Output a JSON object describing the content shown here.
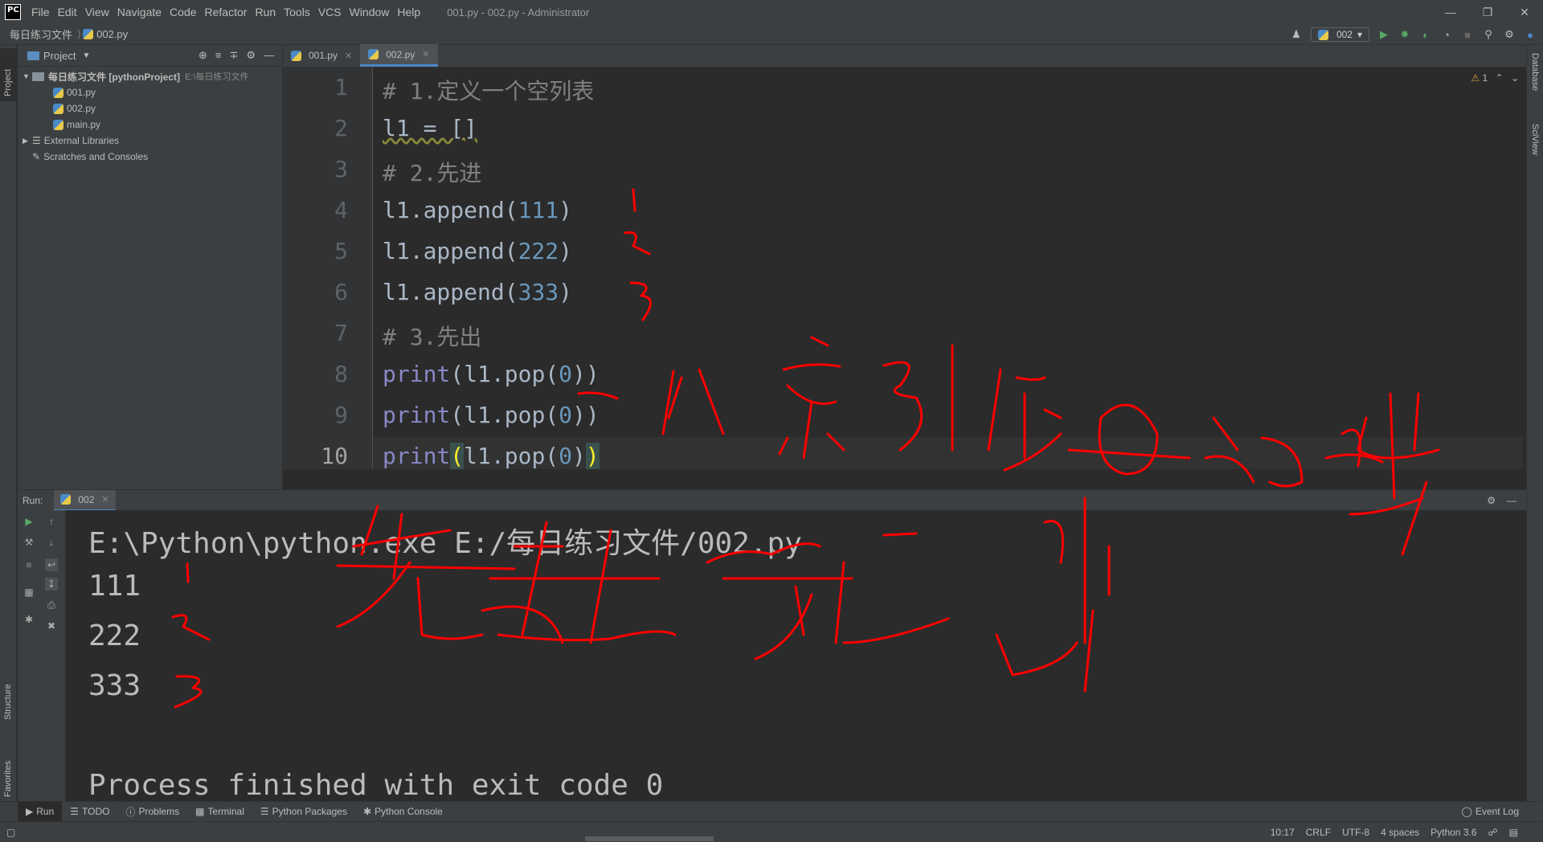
{
  "titlebar": {
    "logo_text": "PC",
    "menus": [
      "File",
      "Edit",
      "View",
      "Navigate",
      "Code",
      "Refactor",
      "Run",
      "Tools",
      "VCS",
      "Window",
      "Help"
    ],
    "window_title": "001.py - 002.py - Administrator"
  },
  "navbar": {
    "project": "每日练习文件",
    "file": "002.py",
    "run_config": "002"
  },
  "project_panel": {
    "header": "Project",
    "root_name": "每日练习文件 [pythonProject]",
    "root_path": "E:\\每日练习文件",
    "files": [
      "001.py",
      "002.py",
      "main.py"
    ],
    "external_libraries": "External Libraries",
    "scratches": "Scratches and Consoles"
  },
  "left_stripe": {
    "project": "Project",
    "structure": "Structure",
    "favorites": "Favorites"
  },
  "right_stripe": {
    "database": "Database",
    "sciview": "SciView"
  },
  "editor": {
    "tabs": [
      {
        "label": "001.py",
        "active": false
      },
      {
        "label": "002.py",
        "active": true
      }
    ],
    "warning_count": "1",
    "line_numbers": [
      "1",
      "2",
      "3",
      "4",
      "5",
      "6",
      "7",
      "8",
      "9",
      "10"
    ],
    "lines": {
      "l1_comment": "# 1.定义一个空列表",
      "l2_var": "l1 = []",
      "l3_comment": "# 2.先进",
      "l4_obj": "l1.append(",
      "l4_num": "111",
      "l5_obj": "l1.append(",
      "l5_num": "222",
      "l6_obj": "l1.append(",
      "l6_num": "333",
      "close_paren": ")",
      "l7_comment": "# 3.先出",
      "print_kw": "print",
      "pop_open": "(l1.pop(",
      "pop_zero": "0",
      "pop_close": "))",
      "l10_open": "(",
      "l10_mid": "l1.pop(",
      "l10_close_a": ")",
      "l10_close_b": ")"
    }
  },
  "run_panel": {
    "label": "Run:",
    "tab": "002",
    "console": [
      "E:\\Python\\python.exe E:/每日练习文件/002.py",
      "111",
      "222",
      "333",
      "",
      "Process finished with exit code 0"
    ]
  },
  "bottom_bar": {
    "items": [
      "Run",
      "TODO",
      "Problems",
      "Terminal",
      "Python Packages",
      "Python Console"
    ],
    "event_log": "Event Log"
  },
  "status_bar": {
    "position": "10:17",
    "line_sep": "CRLF",
    "encoding": "UTF-8",
    "indent": "4 spaces",
    "interpreter": "Python 3.6"
  },
  "annotation_color": "#ff0000"
}
